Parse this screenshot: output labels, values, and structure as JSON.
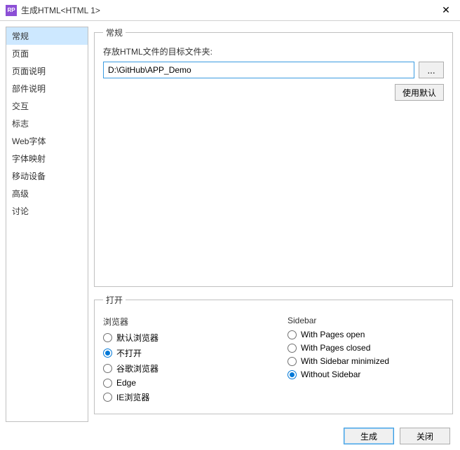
{
  "titlebar": {
    "app_badge": "RP",
    "title": "生成HTML<HTML 1>",
    "close": "✕"
  },
  "sidebar": {
    "items": [
      {
        "label": "常规",
        "selected": true
      },
      {
        "label": "页面"
      },
      {
        "label": "页面说明"
      },
      {
        "label": "部件说明"
      },
      {
        "label": "交互"
      },
      {
        "label": "标志"
      },
      {
        "label": "Web字体"
      },
      {
        "label": "字体映射"
      },
      {
        "label": "移动设备"
      },
      {
        "label": "高级"
      },
      {
        "label": "讨论"
      }
    ]
  },
  "general": {
    "legend": "常规",
    "path_label": "存放HTML文件的目标文件夹:",
    "path_value": "D:\\GitHub\\APP_Demo",
    "browse_label": "...",
    "default_btn": "使用默认"
  },
  "open": {
    "legend": "打开",
    "browser_title": "浏览器",
    "browsers": [
      {
        "label": "默认浏览器",
        "checked": false
      },
      {
        "label": "不打开",
        "checked": true
      },
      {
        "label": "谷歌浏览器",
        "checked": false
      },
      {
        "label": "Edge",
        "checked": false
      },
      {
        "label": "IE浏览器",
        "checked": false
      }
    ],
    "sidebar_title": "Sidebar",
    "sidebar_opts": [
      {
        "label": "With Pages open",
        "checked": false
      },
      {
        "label": "With Pages closed",
        "checked": false
      },
      {
        "label": "With Sidebar minimized",
        "checked": false
      },
      {
        "label": "Without Sidebar",
        "checked": true
      }
    ]
  },
  "footer": {
    "generate": "生成",
    "close": "关闭"
  }
}
